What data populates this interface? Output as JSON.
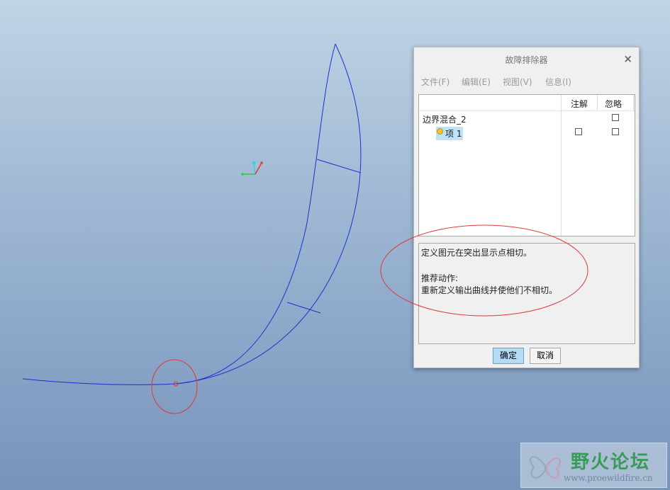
{
  "dialog": {
    "title": "故障排除器",
    "close": "×",
    "menu": [
      "文件(F)",
      "编辑(E)",
      "视图(V)",
      "信息(I)"
    ],
    "columns": {
      "note": "注解",
      "ignore": "忽略"
    },
    "tree": {
      "root": "边界混合_2",
      "item": "项 1"
    },
    "message": {
      "line1": "定义图元在突出显示点相切。",
      "line2": "推荐动作:",
      "line3": "重新定义输出曲线并使他们不相切。"
    },
    "buttons": {
      "ok": "确定",
      "cancel": "取消"
    }
  },
  "colors": {
    "curve": "#1f2fd1",
    "annotation": "#e0383c",
    "selected_row": "#bde3f7"
  },
  "watermark": {
    "title": "野火论坛",
    "url": "www.proewildfire.cn"
  }
}
